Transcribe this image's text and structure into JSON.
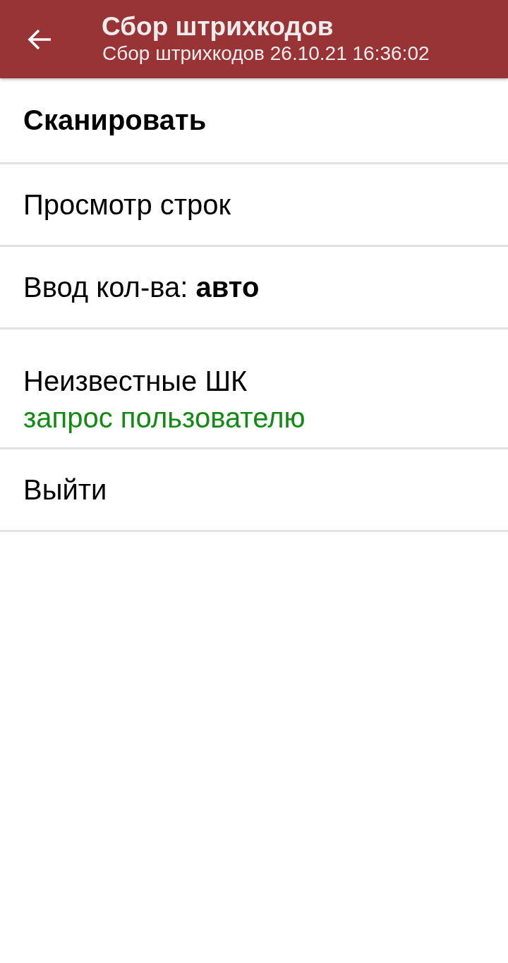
{
  "header": {
    "title": "Сбор штрихкодов",
    "subtitle": "Сбор штрихкодов 26.10.21 16:36:02"
  },
  "menu": [
    {
      "kind": "primary",
      "label": "Сканировать"
    },
    {
      "kind": "plain",
      "label": "Просмотр строк"
    },
    {
      "kind": "plain",
      "label": "Ввод кол-ва: **авто**"
    },
    {
      "kind": "setting",
      "label": "Неизвестные ШК",
      "value": "запрос пользователю"
    },
    {
      "kind": "plain",
      "label": "Выйти"
    }
  ]
}
